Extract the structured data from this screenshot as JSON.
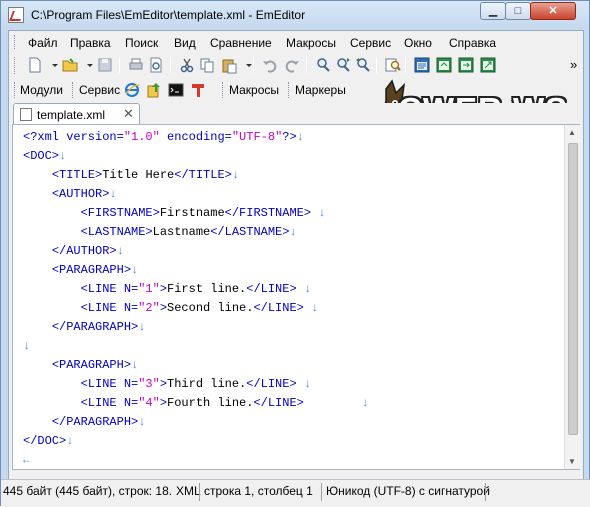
{
  "window": {
    "title": "C:\\Program Files\\EmEditor\\template.xml - EmEditor",
    "min_icon": "minimize-icon",
    "max_icon": "maximize-icon",
    "close_icon": "close-icon"
  },
  "menu": {
    "items": [
      "Файл",
      "Правка",
      "Поиск",
      "Вид",
      "Сравнение",
      "Макросы",
      "Сервис",
      "Окно",
      "Справка"
    ]
  },
  "toolbar": {
    "icons": [
      "new-file-icon",
      "open-folder-icon",
      "save-icon",
      "print-icon",
      "print-preview-icon",
      "cut-icon",
      "copy-icon",
      "paste-icon",
      "undo-icon",
      "redo-icon",
      "find-icon",
      "find-next-icon",
      "find-prev-icon",
      "find-in-files-icon",
      "window-1-icon",
      "window-2-icon",
      "window-3-icon",
      "window-4-icon"
    ],
    "overflow": "»"
  },
  "toolbar2": {
    "modules_label": "Модули",
    "service_label": "Сервис",
    "macros_label": "Макросы",
    "markers_label": "Маркеры",
    "icons": [
      "internet-explorer-icon",
      "upload-icon",
      "command-prompt-icon",
      "tool-icon"
    ]
  },
  "watermark": {
    "text": "CWER.WS"
  },
  "tab": {
    "label": "template.xml",
    "close": "✕"
  },
  "editor": {
    "lines": [
      [
        [
          "pi",
          "<?xml version="
        ],
        [
          "str",
          "\"1.0\""
        ],
        [
          "pi",
          " encoding="
        ],
        [
          "str",
          "\"UTF-8\""
        ],
        [
          "pi",
          "?>"
        ],
        [
          "eol",
          "↓"
        ]
      ],
      [
        [
          "tag",
          "<DOC>"
        ],
        [
          "eol",
          "↓"
        ]
      ],
      [
        [
          "txt",
          "    "
        ],
        [
          "tag",
          "<TITLE>"
        ],
        [
          "txt",
          "Title Here"
        ],
        [
          "tag",
          "</TITLE>"
        ],
        [
          "eol",
          "↓"
        ]
      ],
      [
        [
          "txt",
          "    "
        ],
        [
          "tag",
          "<AUTHOR>"
        ],
        [
          "eol",
          "↓"
        ]
      ],
      [
        [
          "txt",
          "        "
        ],
        [
          "tag",
          "<FIRSTNAME>"
        ],
        [
          "txt",
          "Firstname"
        ],
        [
          "tag",
          "</FIRSTNAME>"
        ],
        [
          "txt",
          " "
        ],
        [
          "eol",
          "↓"
        ]
      ],
      [
        [
          "txt",
          "        "
        ],
        [
          "tag",
          "<LASTNAME>"
        ],
        [
          "txt",
          "Lastname"
        ],
        [
          "tag",
          "</LASTNAME>"
        ],
        [
          "eol",
          "↓"
        ]
      ],
      [
        [
          "txt",
          "    "
        ],
        [
          "tag",
          "</AUTHOR>"
        ],
        [
          "eol",
          "↓"
        ]
      ],
      [
        [
          "txt",
          "    "
        ],
        [
          "tag",
          "<PARAGRAPH>"
        ],
        [
          "eol",
          "↓"
        ]
      ],
      [
        [
          "txt",
          "        "
        ],
        [
          "tag",
          "<LINE N="
        ],
        [
          "str",
          "\"1\""
        ],
        [
          "tag",
          ">"
        ],
        [
          "txt",
          "First line."
        ],
        [
          "tag",
          "</LINE>"
        ],
        [
          "txt",
          " "
        ],
        [
          "eol",
          "↓"
        ]
      ],
      [
        [
          "txt",
          "        "
        ],
        [
          "tag",
          "<LINE N="
        ],
        [
          "str",
          "\"2\""
        ],
        [
          "tag",
          ">"
        ],
        [
          "txt",
          "Second line."
        ],
        [
          "tag",
          "</LINE>"
        ],
        [
          "txt",
          " "
        ],
        [
          "eol",
          "↓"
        ]
      ],
      [
        [
          "txt",
          "    "
        ],
        [
          "tag",
          "</PARAGRAPH>"
        ],
        [
          "eol",
          "↓"
        ]
      ],
      [
        [
          "eol",
          "↓"
        ]
      ],
      [
        [
          "txt",
          "    "
        ],
        [
          "tag",
          "<PARAGRAPH>"
        ],
        [
          "eol",
          "↓"
        ]
      ],
      [
        [
          "txt",
          "        "
        ],
        [
          "tag",
          "<LINE N="
        ],
        [
          "str",
          "\"3\""
        ],
        [
          "tag",
          ">"
        ],
        [
          "txt",
          "Third line."
        ],
        [
          "tag",
          "</LINE>"
        ],
        [
          "txt",
          " "
        ],
        [
          "eol",
          "↓"
        ]
      ],
      [
        [
          "txt",
          "        "
        ],
        [
          "tag",
          "<LINE N="
        ],
        [
          "str",
          "\"4\""
        ],
        [
          "tag",
          ">"
        ],
        [
          "txt",
          "Fourth line."
        ],
        [
          "tag",
          "</LINE>"
        ],
        [
          "txt",
          "        "
        ],
        [
          "eol",
          "↓"
        ]
      ],
      [
        [
          "txt",
          "    "
        ],
        [
          "tag",
          "</PARAGRAPH>"
        ],
        [
          "eol",
          "↓"
        ]
      ],
      [
        [
          "tag",
          "</DOC>"
        ],
        [
          "eol",
          "↓"
        ]
      ],
      [
        [
          "eol",
          "←"
        ]
      ]
    ]
  },
  "status": {
    "size": "445 байт (445 байт), строк: 18.",
    "type": "XML",
    "position": "строка 1, столбец 1",
    "encoding": "Юникод (UTF-8) с сигнатурой"
  },
  "colors": {
    "tag": "#0000c8",
    "string": "#c800c8",
    "eol_marker": "#4a8de0"
  }
}
